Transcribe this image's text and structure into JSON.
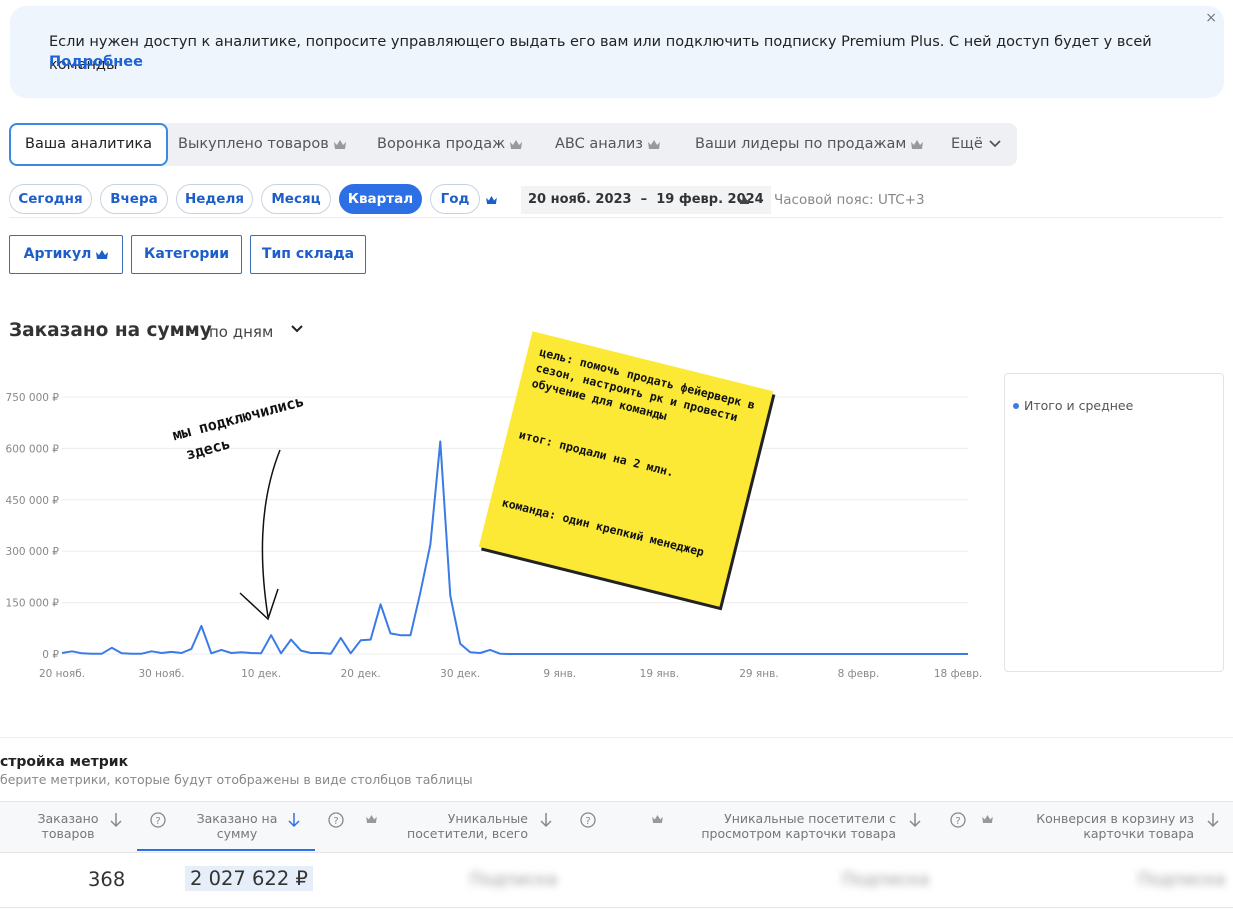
{
  "banner": {
    "text": "Если нужен доступ к аналитике, попросите управляющего выдать его вам или подключить подписку Premium Plus. С ней доступ будет у всей команды",
    "link": "Подробнее",
    "close": "×"
  },
  "tabs": [
    {
      "label": "Ваша аналитика",
      "active": true,
      "premium": false
    },
    {
      "label": "Выкуплено товаров",
      "premium": true
    },
    {
      "label": "Воронка продаж",
      "premium": true
    },
    {
      "label": "ABC анализ",
      "premium": true
    },
    {
      "label": "Ваши лидеры по продажам",
      "premium": true
    },
    {
      "label": "Ещё",
      "premium": false
    }
  ],
  "periods": [
    {
      "label": "Сегодня"
    },
    {
      "label": "Вчера"
    },
    {
      "label": "Неделя"
    },
    {
      "label": "Месяц"
    },
    {
      "label": "Квартал",
      "active": true
    },
    {
      "label": "Год"
    }
  ],
  "date_range": "20 нояб. 2023  –  19 февр. 2024",
  "timezone": "Часовой пояс: UTC+3",
  "filters": [
    {
      "label": "Артикул",
      "premium": true
    },
    {
      "label": "Категории"
    },
    {
      "label": "Тип склада"
    }
  ],
  "chart_heading": {
    "title": "Заказано на сумму",
    "granularity": "по дням"
  },
  "colors": {
    "accent": "#2d6fe4",
    "line": "#3b7be8",
    "note": "#fbe936"
  },
  "chart_data": {
    "type": "line",
    "xlabel": "",
    "ylabel": "",
    "ylim": [
      0,
      750000
    ],
    "y_ticks": [
      "750 000 ₽",
      "600 000 ₽",
      "450 000 ₽",
      "300 000 ₽",
      "150 000 ₽",
      "0 ₽"
    ],
    "y_tick_values": [
      750000,
      600000,
      450000,
      300000,
      150000,
      0
    ],
    "x_ticks": [
      "20 нояб.",
      "30 нояб.",
      "10 дек.",
      "20 дек.",
      "30 дек.",
      "9 янв.",
      "19 янв.",
      "29 янв.",
      "8 февр.",
      "18 февр."
    ],
    "grid": true,
    "series": [
      {
        "name": "Итого и среднее",
        "values": [
          3000,
          8000,
          2000,
          1000,
          1000,
          18000,
          2000,
          1000,
          1000,
          8000,
          3000,
          6000,
          3000,
          15000,
          82000,
          2000,
          12000,
          3000,
          5000,
          3000,
          2000,
          55000,
          2000,
          42000,
          10000,
          3000,
          3000,
          1000,
          47000,
          2000,
          40000,
          42000,
          145000,
          60000,
          55000,
          55000,
          180000,
          320000,
          620000,
          170000,
          30000,
          5000,
          3000,
          12000,
          1000,
          0,
          0,
          0,
          0,
          0,
          0,
          0,
          0,
          0,
          0,
          0,
          0,
          0,
          0,
          0,
          0,
          0,
          0,
          0,
          0,
          0,
          0,
          0,
          0,
          0,
          0,
          0,
          0,
          0,
          0,
          0,
          0,
          0,
          0,
          0,
          0,
          0,
          0,
          0,
          0,
          0,
          0,
          0,
          0,
          0,
          0,
          0
        ]
      }
    ]
  },
  "legend": {
    "label": "Итого и среднее"
  },
  "note": {
    "goal": "цель: помочь продать фейерверк в сезон, настроить рк и провести обучение для команды",
    "result": "итог: продали на 2 млн.",
    "team": "команда: один крепкий менеджер"
  },
  "annotation": {
    "line1": "мы подключились",
    "line2": "здесь"
  },
  "metrics": {
    "title": "стройка метрик",
    "subtitle": "берите метрики, которые будут отображены в виде столбцов таблицы",
    "columns": [
      {
        "label": "Заказано товаров",
        "value": "368"
      },
      {
        "label": "Заказано на сумму",
        "value": "2 027 622 ₽",
        "active": true
      },
      {
        "label": "Уникальные посетители, всего",
        "value": "Подписка",
        "premium": true
      },
      {
        "label": "Уникальные посетители с просмотром карточки товара",
        "value": "Подписка",
        "premium": true
      },
      {
        "label": "Конверсия в корзину из карточки товара",
        "value": "Подписка",
        "premium": true
      }
    ]
  }
}
